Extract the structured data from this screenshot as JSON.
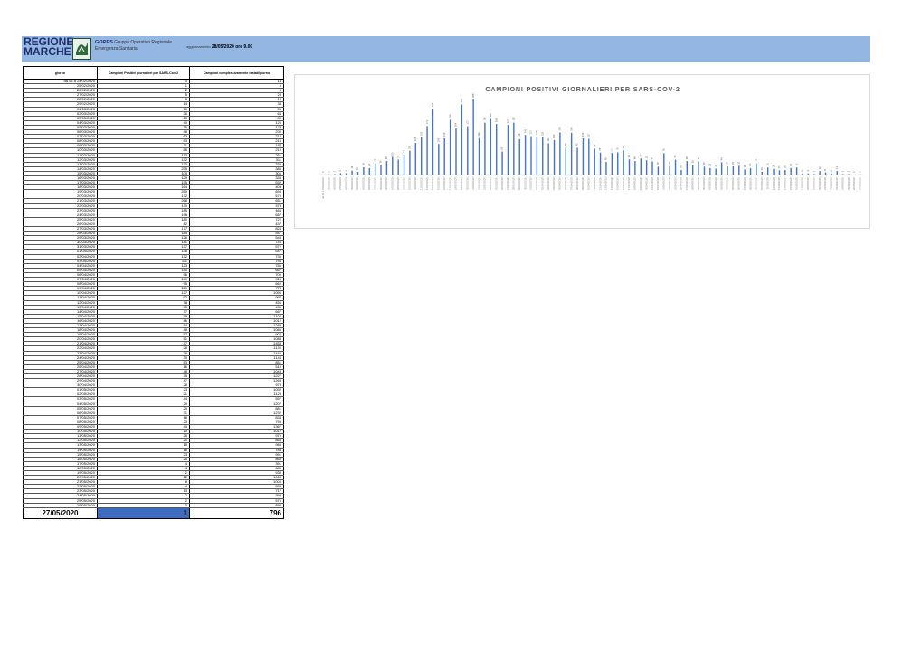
{
  "header": {
    "logo_line1": "REGIONE",
    "logo_line2": "MARCHE",
    "gores": "GORES",
    "gores_desc1": "Gruppo Operativo Regionale",
    "gores_desc2": "Emergenza Sanitaria",
    "update_label": "aggiornamento",
    "update_value": "28/05/2020 ore 9.00"
  },
  "table": {
    "headers": [
      "giorno",
      "Campioni Positivi giornalieri per SARS-Cov-2",
      "Campioni complessivamente testati/giorno"
    ],
    "rows": [
      [
        "da 06 a 24/02/2020",
        "0",
        "14"
      ],
      [
        "25/02/2020",
        "1",
        "5"
      ],
      [
        "26/02/2020",
        "2",
        "8"
      ],
      [
        "27/02/2020",
        "5",
        "28"
      ],
      [
        "28/02/2020",
        "5",
        "19"
      ],
      [
        "29/02/2020",
        "14",
        "33"
      ],
      [
        "01/03/2020",
        "10",
        "36"
      ],
      [
        "02/03/2020",
        "26",
        "64"
      ],
      [
        "03/03/2020",
        "23",
        "89"
      ],
      [
        "04/03/2020",
        "40",
        "126"
      ],
      [
        "05/03/2020",
        "35",
        "173"
      ],
      [
        "06/03/2020",
        "48",
        "230"
      ],
      [
        "07/03/2020",
        "63",
        "218"
      ],
      [
        "08/03/2020",
        "53",
        "216"
      ],
      [
        "09/03/2020",
        "71",
        "187"
      ],
      [
        "10/03/2020",
        "85",
        "219"
      ],
      [
        "11/03/2020",
        "113",
        "251"
      ],
      [
        "12/03/2020",
        "132",
        "311"
      ],
      [
        "13/03/2020",
        "173",
        "339"
      ],
      [
        "14/03/2020",
        "235",
        "386"
      ],
      [
        "15/03/2020",
        "109",
        "306"
      ],
      [
        "16/03/2020",
        "129",
        "335"
      ],
      [
        "17/03/2020",
        "195",
        "532"
      ],
      [
        "18/03/2020",
        "164",
        "403"
      ],
      [
        "19/03/2020",
        "250",
        "698"
      ],
      [
        "20/03/2020",
        "172",
        "579"
      ],
      [
        "21/03/2020",
        "268",
        "651"
      ],
      [
        "22/03/2020",
        "130",
        "373"
      ],
      [
        "23/03/2020",
        "185",
        "465"
      ],
      [
        "24/03/2020",
        "198",
        "667"
      ],
      [
        "25/03/2020",
        "180",
        "722"
      ],
      [
        "26/03/2020",
        "82",
        "437"
      ],
      [
        "27/03/2020",
        "177",
        "824"
      ],
      [
        "28/03/2020",
        "185",
        "547"
      ],
      [
        "29/03/2020",
        "126",
        "548"
      ],
      [
        "30/03/2020",
        "141",
        "745"
      ],
      [
        "31/03/2020",
        "137",
        "572"
      ],
      [
        "01/04/2020",
        "136",
        "647"
      ],
      [
        "02/04/2020",
        "132",
        "735"
      ],
      [
        "03/04/2020",
        "111",
        "794"
      ],
      [
        "04/04/2020",
        "123",
        "780"
      ],
      [
        "05/04/2020",
        "150",
        "667"
      ],
      [
        "06/04/2020",
        "96",
        "700"
      ],
      [
        "07/04/2020",
        "149",
        "913"
      ],
      [
        "08/04/2020",
        "95",
        "662"
      ],
      [
        "09/04/2020",
        "129",
        "776"
      ],
      [
        "10/04/2020",
        "127",
        "1090"
      ],
      [
        "11/04/2020",
        "92",
        "997"
      ],
      [
        "12/04/2020",
        "78",
        "456"
      ],
      [
        "13/04/2020",
        "45",
        "436"
      ],
      [
        "14/04/2020",
        "77",
        "667"
      ],
      [
        "15/04/2020",
        "79",
        "1107"
      ],
      [
        "16/04/2020",
        "86",
        "1012"
      ],
      [
        "17/04/2020",
        "54",
        "1283"
      ],
      [
        "18/04/2020",
        "48",
        "1086"
      ],
      [
        "19/04/2020",
        "57",
        "907"
      ],
      [
        "20/04/2020",
        "51",
        "1084"
      ],
      [
        "21/04/2020",
        "47",
        "1453"
      ],
      [
        "22/04/2020",
        "28",
        "1130"
      ],
      [
        "23/04/2020",
        "76",
        "1440"
      ],
      [
        "24/04/2020",
        "30",
        "1143"
      ],
      [
        "25/04/2020",
        "53",
        "851"
      ],
      [
        "26/04/2020",
        "16",
        "510"
      ],
      [
        "27/04/2020",
        "48",
        "1043"
      ],
      [
        "28/04/2020",
        "35",
        "1227"
      ],
      [
        "29/04/2020",
        "47",
        "1268"
      ],
      [
        "30/04/2020",
        "28",
        "978"
      ],
      [
        "01/05/2020",
        "23",
        "1032"
      ],
      [
        "02/05/2020",
        "21",
        "1125"
      ],
      [
        "03/05/2020",
        "44",
        "557"
      ],
      [
        "04/05/2020",
        "29",
        "1207"
      ],
      [
        "05/05/2020",
        "29",
        "881"
      ],
      [
        "06/05/2020",
        "31",
        "1232"
      ],
      [
        "07/05/2020",
        "18",
        "834"
      ],
      [
        "08/05/2020",
        "23",
        "795"
      ],
      [
        "09/05/2020",
        "40",
        "1367"
      ],
      [
        "10/05/2020",
        "10",
        "1012"
      ],
      [
        "11/05/2020",
        "25",
        "970"
      ],
      [
        "12/05/2020",
        "20",
        "865"
      ],
      [
        "13/05/2020",
        "15",
        "989"
      ],
      [
        "14/05/2020",
        "16",
        "783"
      ],
      [
        "15/05/2020",
        "23",
        "991"
      ],
      [
        "16/05/2020",
        "25",
        "863"
      ],
      [
        "17/05/2020",
        "4",
        "391"
      ],
      [
        "18/05/2020",
        "4",
        "680"
      ],
      [
        "19/05/2020",
        "2",
        "930"
      ],
      [
        "20/05/2020",
        "12",
        "1063"
      ],
      [
        "21/05/2020",
        "8",
        "1006"
      ],
      [
        "22/05/2020",
        "4",
        "559"
      ],
      [
        "23/05/2020",
        "13",
        "717"
      ],
      [
        "24/05/2020",
        "2",
        "398"
      ],
      [
        "25/05/2020",
        "2",
        "576"
      ],
      [
        "26/05/2020",
        "0",
        "892"
      ]
    ],
    "total": [
      "27/05/2020",
      "1",
      "796"
    ]
  },
  "chart_data": {
    "type": "bar",
    "title": "CAMPIONI POSITIVI GIORNALIERI PER SARS-COV-2",
    "xlabel": "",
    "ylabel": "",
    "grid": false,
    "categories": [
      "da 06 a 24/02/2020",
      "25/02/2020",
      "26/02/2020",
      "27/02/2020",
      "28/02/2020",
      "29/02/2020",
      "01/03/2020",
      "02/03/2020",
      "03/03/2020",
      "04/03/2020",
      "05/03/2020",
      "06/03/2020",
      "07/03/2020",
      "08/03/2020",
      "09/03/2020",
      "10/03/2020",
      "11/03/2020",
      "12/03/2020",
      "13/03/2020",
      "14/03/2020",
      "15/03/2020",
      "16/03/2020",
      "17/03/2020",
      "18/03/2020",
      "19/03/2020",
      "20/03/2020",
      "21/03/2020",
      "22/03/2020",
      "23/03/2020",
      "24/03/2020",
      "25/03/2020",
      "26/03/2020",
      "27/03/2020",
      "28/03/2020",
      "29/03/2020",
      "30/03/2020",
      "31/03/2020",
      "01/04/2020",
      "02/04/2020",
      "03/04/2020",
      "04/04/2020",
      "05/04/2020",
      "06/04/2020",
      "07/04/2020",
      "08/04/2020",
      "09/04/2020",
      "10/04/2020",
      "11/04/2020",
      "12/04/2020",
      "13/04/2020",
      "14/04/2020",
      "15/04/2020",
      "16/04/2020",
      "17/04/2020",
      "18/04/2020",
      "19/04/2020",
      "20/04/2020",
      "21/04/2020",
      "22/04/2020",
      "23/04/2020",
      "24/04/2020",
      "25/04/2020",
      "26/04/2020",
      "27/04/2020",
      "28/04/2020",
      "29/04/2020",
      "30/04/2020",
      "01/05/2020",
      "02/05/2020",
      "03/05/2020",
      "04/05/2020",
      "05/05/2020",
      "06/05/2020",
      "07/05/2020",
      "08/05/2020",
      "09/05/2020",
      "10/05/2020",
      "11/05/2020",
      "12/05/2020",
      "13/05/2020",
      "14/05/2020",
      "15/05/2020",
      "16/05/2020",
      "17/05/2020",
      "18/05/2020",
      "19/05/2020",
      "20/05/2020",
      "21/05/2020",
      "22/05/2020",
      "23/05/2020",
      "24/05/2020",
      "25/05/2020",
      "26/05/2020",
      "27/05/2020"
    ],
    "values": [
      0,
      1,
      2,
      5,
      5,
      14,
      10,
      26,
      23,
      40,
      35,
      48,
      63,
      53,
      71,
      85,
      113,
      132,
      173,
      235,
      109,
      129,
      195,
      164,
      250,
      172,
      268,
      130,
      185,
      198,
      180,
      82,
      177,
      185,
      126,
      141,
      137,
      136,
      132,
      111,
      123,
      150,
      96,
      149,
      95,
      129,
      127,
      92,
      78,
      45,
      77,
      79,
      86,
      54,
      48,
      57,
      51,
      47,
      28,
      76,
      30,
      53,
      16,
      48,
      35,
      47,
      28,
      23,
      21,
      44,
      29,
      29,
      31,
      18,
      23,
      40,
      10,
      25,
      20,
      15,
      16,
      23,
      25,
      4,
      4,
      2,
      12,
      8,
      4,
      13,
      2,
      2,
      0,
      1
    ],
    "ylim": [
      0,
      290
    ],
    "bar_color": "#4472c4"
  }
}
